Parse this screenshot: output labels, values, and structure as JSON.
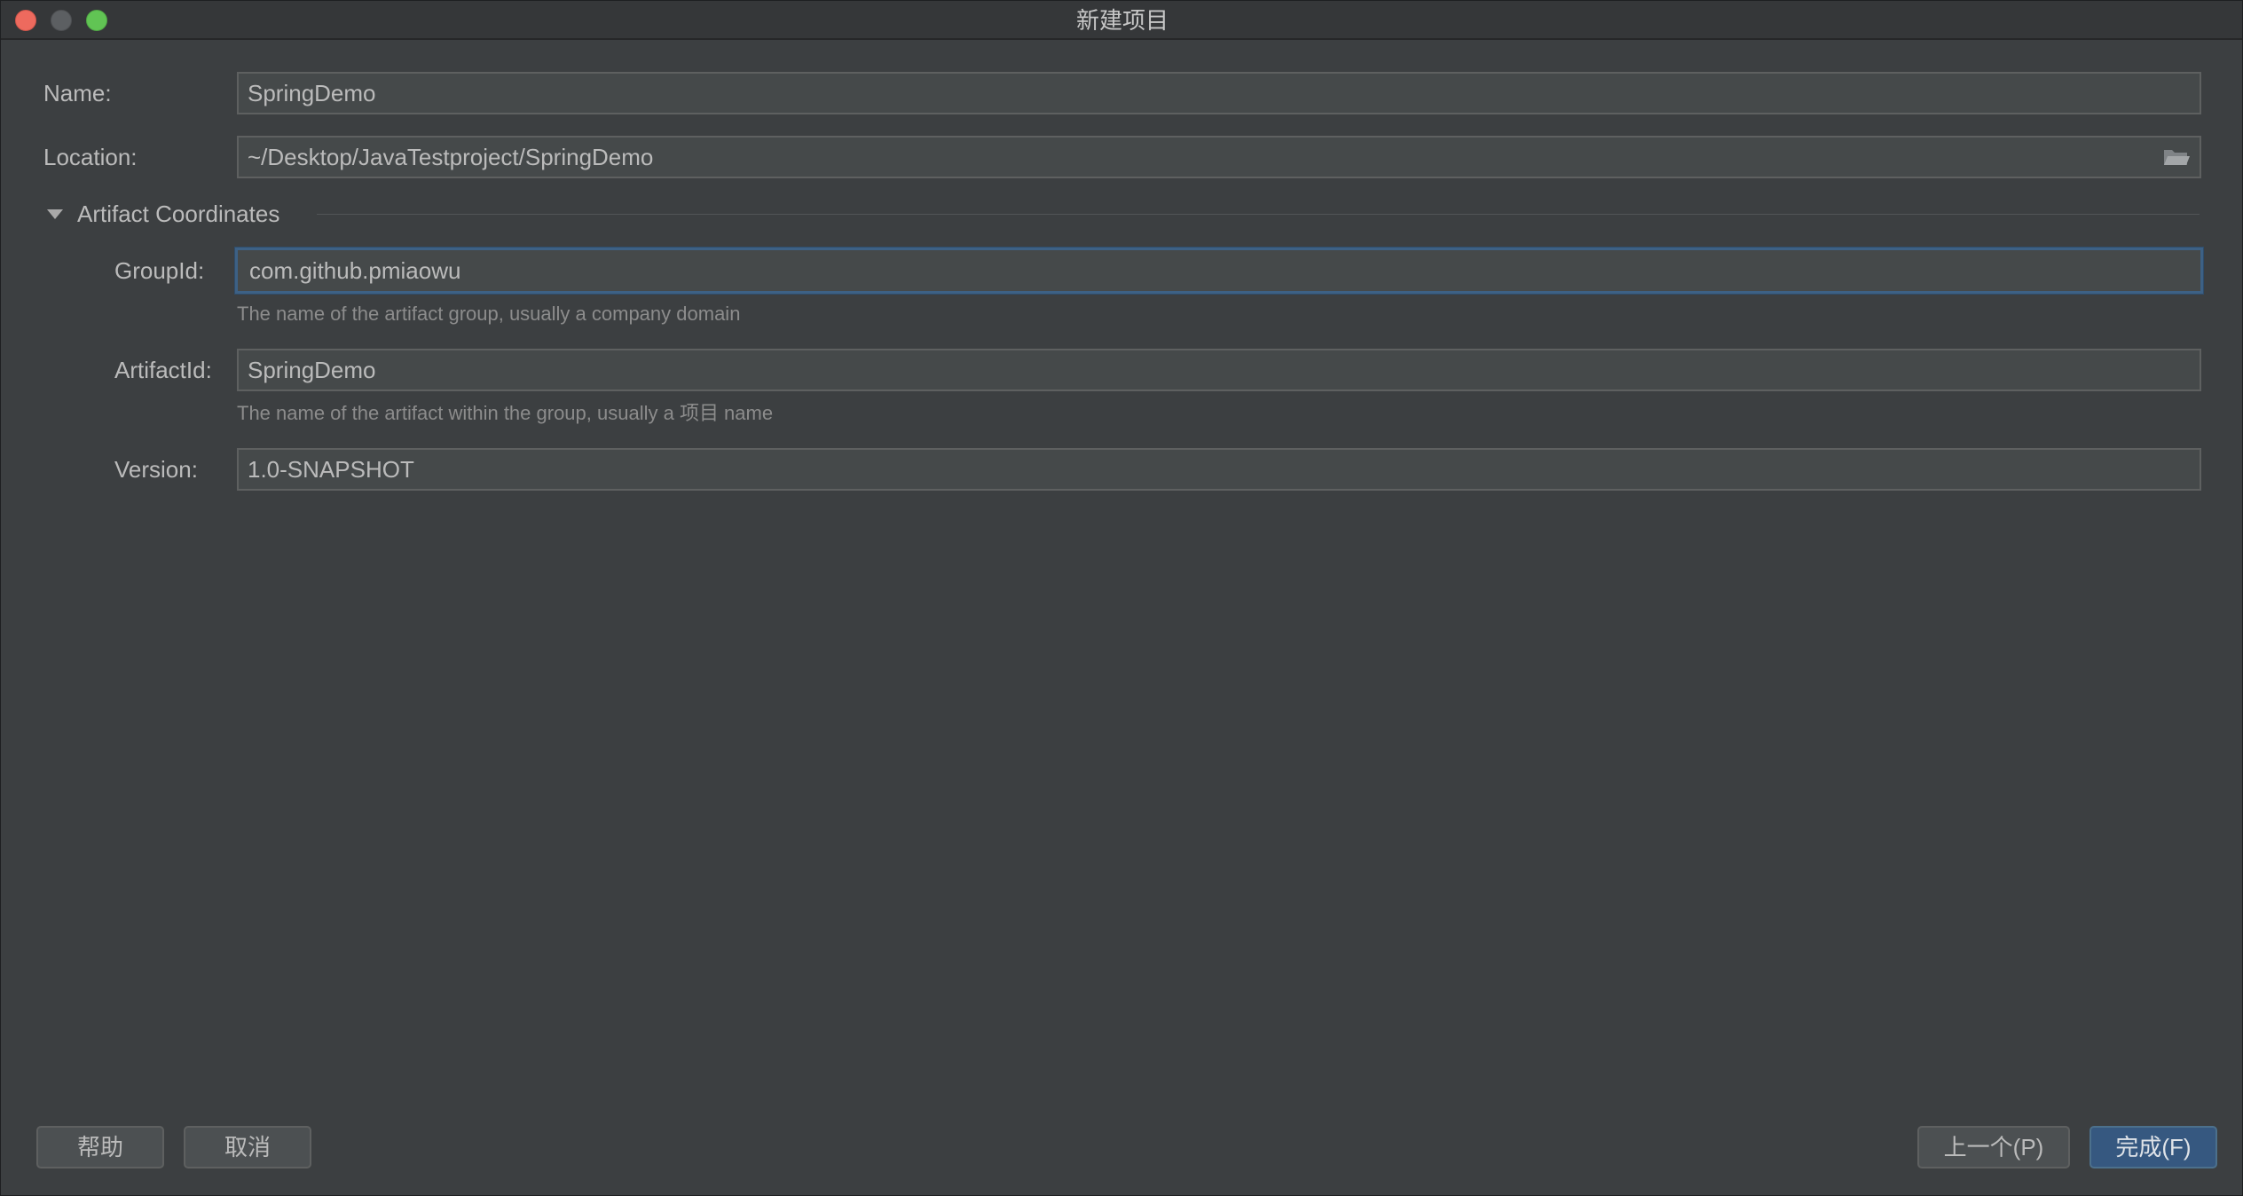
{
  "window": {
    "title": "新建项目"
  },
  "form": {
    "name_label": "Name:",
    "name_value": "SpringDemo",
    "location_label": "Location:",
    "location_value": "~/Desktop/JavaTestproject/SpringDemo",
    "browse_icon": "folder-icon"
  },
  "artifact": {
    "section_title": "Artifact Coordinates",
    "group_label": "GroupId:",
    "group_value": "com.github.pmiaowu",
    "group_hint": "The name of the artifact group, usually a company domain",
    "artifact_label": "ArtifactId:",
    "artifact_value": "SpringDemo",
    "artifact_hint": "The name of the artifact within the group, usually a 项目 name",
    "version_label": "Version:",
    "version_value": "1.0-SNAPSHOT"
  },
  "buttons": {
    "help": "帮助",
    "cancel": "取消",
    "previous": "上一个(P)",
    "finish": "完成(F)"
  },
  "colors": {
    "background": "#3c3f41",
    "field_background": "#45494a",
    "focus_border": "#3d6185",
    "primary_button": "#365880"
  }
}
